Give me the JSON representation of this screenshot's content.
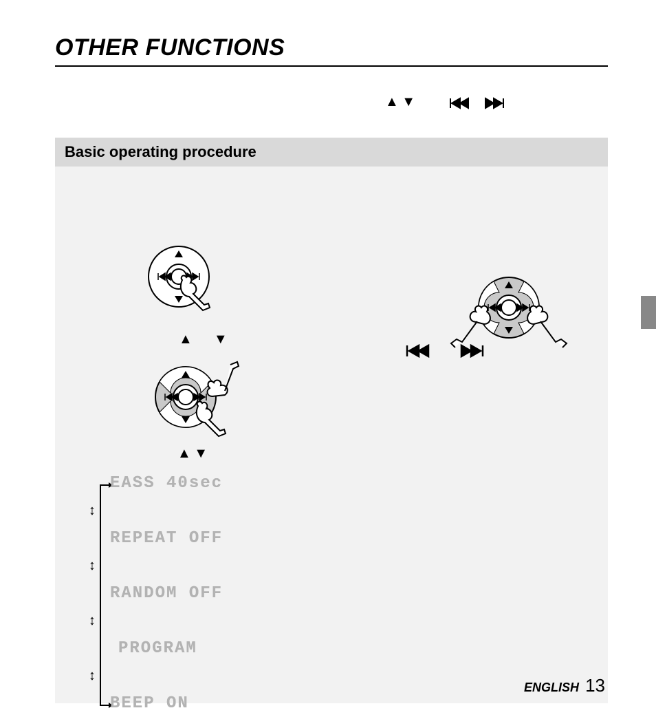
{
  "title": "OTHER FUNCTIONS",
  "section_header": "Basic operating procedure",
  "menu": {
    "item1": "EASS 40sec",
    "item2": "REPEAT OFF",
    "item3": "RANDOM OFF",
    "item4": "PROGRAM",
    "item5": "BEEP ON"
  },
  "footer": {
    "lang": "ENGLISH",
    "page": "13"
  },
  "icons": {
    "up": "▲",
    "down": "▼",
    "updown_arrow": "↕"
  }
}
